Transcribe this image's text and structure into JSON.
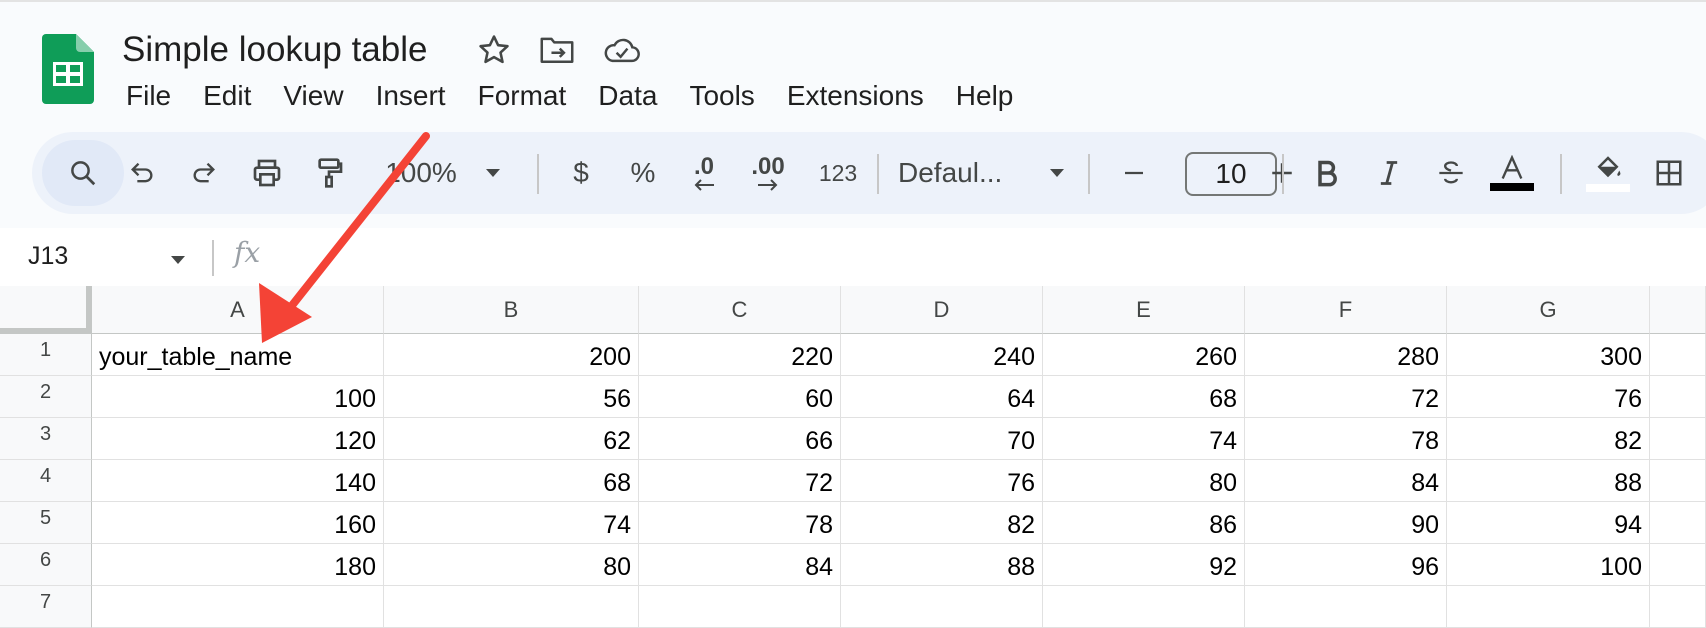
{
  "app": {
    "title": "Simple lookup table",
    "icons": [
      "sheets-logo-icon",
      "star-icon",
      "move-folder-icon",
      "cloud-saved-icon"
    ]
  },
  "menu": [
    "File",
    "Edit",
    "View",
    "Insert",
    "Format",
    "Data",
    "Tools",
    "Extensions",
    "Help"
  ],
  "toolbar": {
    "zoom": "100%",
    "currency": "$",
    "percent": "%",
    "decrease_decimal": ".0",
    "increase_decimal": ".00",
    "number_format": "123",
    "font": "Defaul...",
    "font_size": "10",
    "icons": [
      "search-icon",
      "undo-icon",
      "redo-icon",
      "print-icon",
      "paint-format-icon",
      "minus-icon",
      "plus-icon",
      "bold-icon",
      "italic-icon",
      "strikethrough-icon",
      "text-color-icon",
      "fill-color-icon",
      "borders-icon"
    ]
  },
  "formula_bar": {
    "cell_ref": "J13",
    "fx": "fx",
    "value": ""
  },
  "sheet": {
    "columns": [
      "A",
      "B",
      "C",
      "D",
      "E",
      "F",
      "G"
    ],
    "rows": [
      {
        "n": "1",
        "cells": [
          "your_table_name",
          "200",
          "220",
          "240",
          "260",
          "280",
          "300"
        ]
      },
      {
        "n": "2",
        "cells": [
          "100",
          "56",
          "60",
          "64",
          "68",
          "72",
          "76"
        ]
      },
      {
        "n": "3",
        "cells": [
          "120",
          "62",
          "66",
          "70",
          "74",
          "78",
          "82"
        ]
      },
      {
        "n": "4",
        "cells": [
          "140",
          "68",
          "72",
          "76",
          "80",
          "84",
          "88"
        ]
      },
      {
        "n": "5",
        "cells": [
          "160",
          "74",
          "78",
          "82",
          "86",
          "90",
          "94"
        ]
      },
      {
        "n": "6",
        "cells": [
          "180",
          "80",
          "84",
          "88",
          "92",
          "96",
          "100"
        ]
      },
      {
        "n": "7",
        "cells": [
          "",
          "",
          "",
          "",
          "",
          "",
          ""
        ]
      }
    ]
  },
  "annotation": {
    "arrow_color": "#f44336"
  }
}
